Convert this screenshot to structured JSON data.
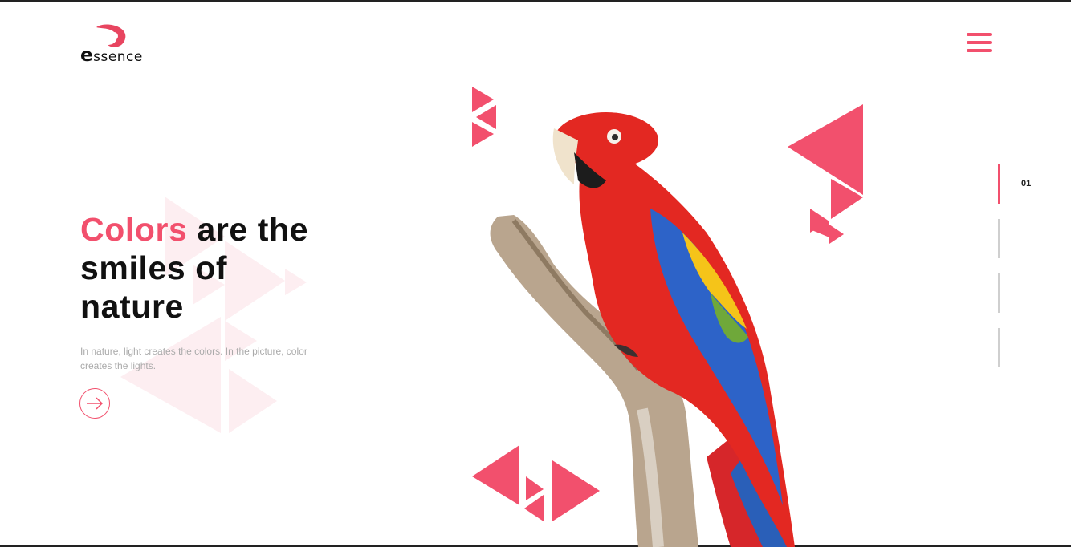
{
  "brand": {
    "name_initial": "e",
    "name_rest": "ssence"
  },
  "header": {
    "menu_icon": "hamburger-icon"
  },
  "hero": {
    "title_accent": "Colors",
    "title_rest_line1": "are the",
    "title_line2": "smiles of",
    "title_line3": "nature",
    "subtitle": "In nature, light creates the colors. In the picture, color creates the lights.",
    "cta_icon": "arrow-right-icon"
  },
  "pager": {
    "current": "01",
    "total_bars": 4,
    "active_index": 0
  },
  "colors": {
    "accent": "#f2506d",
    "text": "#111111",
    "muted": "#aaaaaa"
  }
}
